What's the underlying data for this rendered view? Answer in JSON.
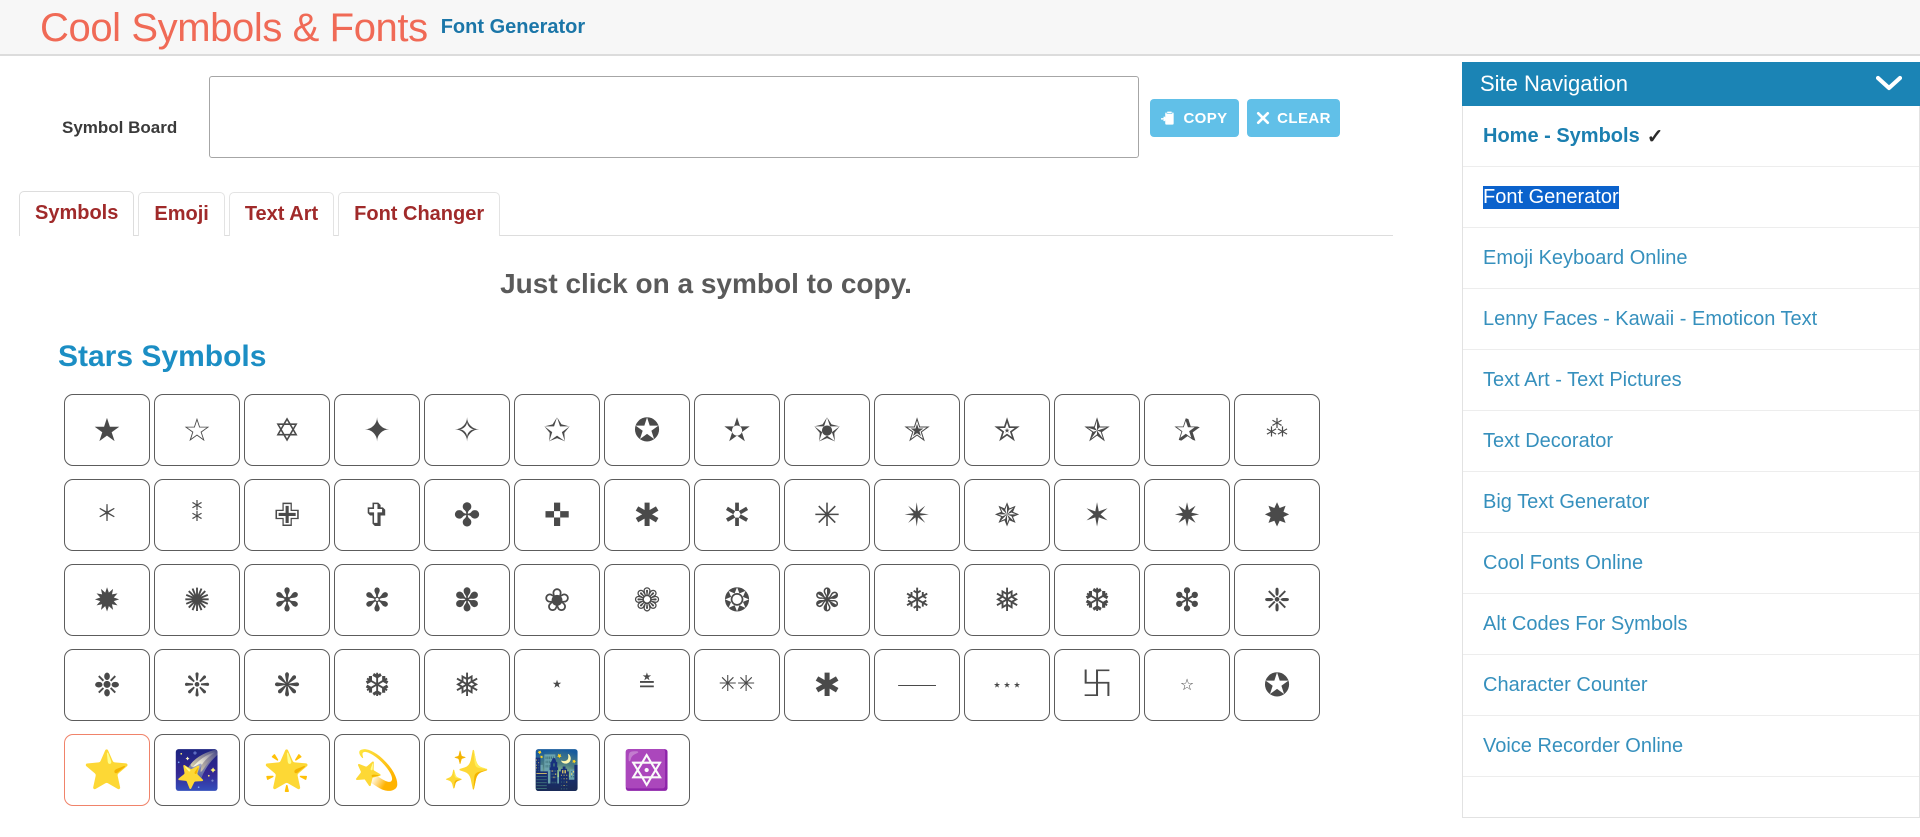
{
  "header": {
    "brand_title": "Cool Symbols & Fonts",
    "brand_subtitle": "Font Generator"
  },
  "board": {
    "label": "Symbol Board",
    "value": "",
    "placeholder": "",
    "copy_label": "COPY",
    "clear_label": "CLEAR",
    "copy_icon": "clipboard-copy-icon",
    "clear_icon": "close-x-icon"
  },
  "tabs": [
    {
      "label": "Symbols",
      "active": true
    },
    {
      "label": "Emoji",
      "active": false
    },
    {
      "label": "Text Art",
      "active": false
    },
    {
      "label": "Font Changer",
      "active": false
    }
  ],
  "main": {
    "click_hint": "Just click on a symbol to copy.",
    "section_title": "Stars Symbols"
  },
  "symbols": [
    {
      "char": "★",
      "size": "normal"
    },
    {
      "char": "☆",
      "size": "normal"
    },
    {
      "char": "✡",
      "size": "normal"
    },
    {
      "char": "✦",
      "size": "normal"
    },
    {
      "char": "✧",
      "size": "normal"
    },
    {
      "char": "✩",
      "size": "normal"
    },
    {
      "char": "✪",
      "size": "normal"
    },
    {
      "char": "✫",
      "size": "normal"
    },
    {
      "char": "✬",
      "size": "normal"
    },
    {
      "char": "✭",
      "size": "normal"
    },
    {
      "char": "✮",
      "size": "normal"
    },
    {
      "char": "✯",
      "size": "normal"
    },
    {
      "char": "✰",
      "size": "normal"
    },
    {
      "char": "⁂",
      "size": "small"
    },
    {
      "char": "＊",
      "size": "small"
    },
    {
      "char": "⁑",
      "size": "small"
    },
    {
      "char": "✙",
      "size": "normal"
    },
    {
      "char": "✞",
      "size": "normal"
    },
    {
      "char": "✤",
      "size": "normal"
    },
    {
      "char": "✜",
      "size": "normal"
    },
    {
      "char": "✱",
      "size": "normal"
    },
    {
      "char": "✲",
      "size": "normal"
    },
    {
      "char": "✳",
      "size": "normal"
    },
    {
      "char": "✴",
      "size": "normal"
    },
    {
      "char": "✵",
      "size": "normal"
    },
    {
      "char": "✶",
      "size": "normal"
    },
    {
      "char": "✷",
      "size": "normal"
    },
    {
      "char": "✸",
      "size": "normal"
    },
    {
      "char": "✹",
      "size": "normal"
    },
    {
      "char": "✺",
      "size": "normal"
    },
    {
      "char": "✻",
      "size": "normal"
    },
    {
      "char": "✼",
      "size": "normal"
    },
    {
      "char": "✽",
      "size": "normal"
    },
    {
      "char": "❀",
      "size": "normal"
    },
    {
      "char": "❁",
      "size": "normal"
    },
    {
      "char": "❂",
      "size": "normal"
    },
    {
      "char": "❃",
      "size": "normal"
    },
    {
      "char": "❄",
      "size": "normal"
    },
    {
      "char": "❅",
      "size": "normal"
    },
    {
      "char": "❆",
      "size": "normal"
    },
    {
      "char": "❇",
      "size": "normal"
    },
    {
      "char": "❈",
      "size": "normal"
    },
    {
      "char": "❉",
      "size": "normal"
    },
    {
      "char": "❊",
      "size": "normal"
    },
    {
      "char": "❋",
      "size": "normal"
    },
    {
      "char": "❆",
      "size": "normal"
    },
    {
      "char": "❅",
      "size": "normal"
    },
    {
      "char": "⋆",
      "size": "small"
    },
    {
      "char": "≛",
      "size": "small"
    },
    {
      "char": "✳✳",
      "size": "small"
    },
    {
      "char": "✱",
      "size": "normal"
    },
    {
      "char": "⸻",
      "size": "tiny"
    },
    {
      "char": "⋆⋆⋆",
      "size": "tiny"
    },
    {
      "char": "࿕",
      "size": "normal"
    },
    {
      "char": "☆",
      "size": "tiny"
    },
    {
      "char": "✪",
      "size": "normal"
    },
    {
      "char": "⭐",
      "size": "emoji",
      "highlight": true
    },
    {
      "char": "🌠",
      "size": "emoji"
    },
    {
      "char": "🌟",
      "size": "emoji"
    },
    {
      "char": "💫",
      "size": "emoji"
    },
    {
      "char": "✨",
      "size": "emoji"
    },
    {
      "char": "🌃",
      "size": "emoji"
    },
    {
      "char": "🔯",
      "size": "emoji"
    }
  ],
  "sidebar": {
    "title": "Site Navigation",
    "chevron_icon": "chevron-down-icon",
    "items": [
      {
        "label": "Home - Symbols",
        "bold": true,
        "check": "✓"
      },
      {
        "label": "Font Generator",
        "selected": true
      },
      {
        "label": "Emoji Keyboard Online"
      },
      {
        "label": "Lenny Faces - Kawaii - Emoticon Text"
      },
      {
        "label": "Text Art - Text Pictures"
      },
      {
        "label": "Text Decorator"
      },
      {
        "label": "Big Text Generator"
      },
      {
        "label": "Cool Fonts Online"
      },
      {
        "label": "Alt Codes For Symbols"
      },
      {
        "label": "Character Counter"
      },
      {
        "label": "Voice Recorder Online"
      }
    ]
  },
  "colors": {
    "brand_red": "#f06a56",
    "brand_blue": "#1b76a8",
    "tab_red": "#a02a2a",
    "button_blue": "#61c0e8",
    "nav_header_blue": "#1b84b5",
    "nav_link_blue": "#3690bd",
    "selection_blue": "#0b62cc",
    "highlight_border": "#f0836a"
  }
}
